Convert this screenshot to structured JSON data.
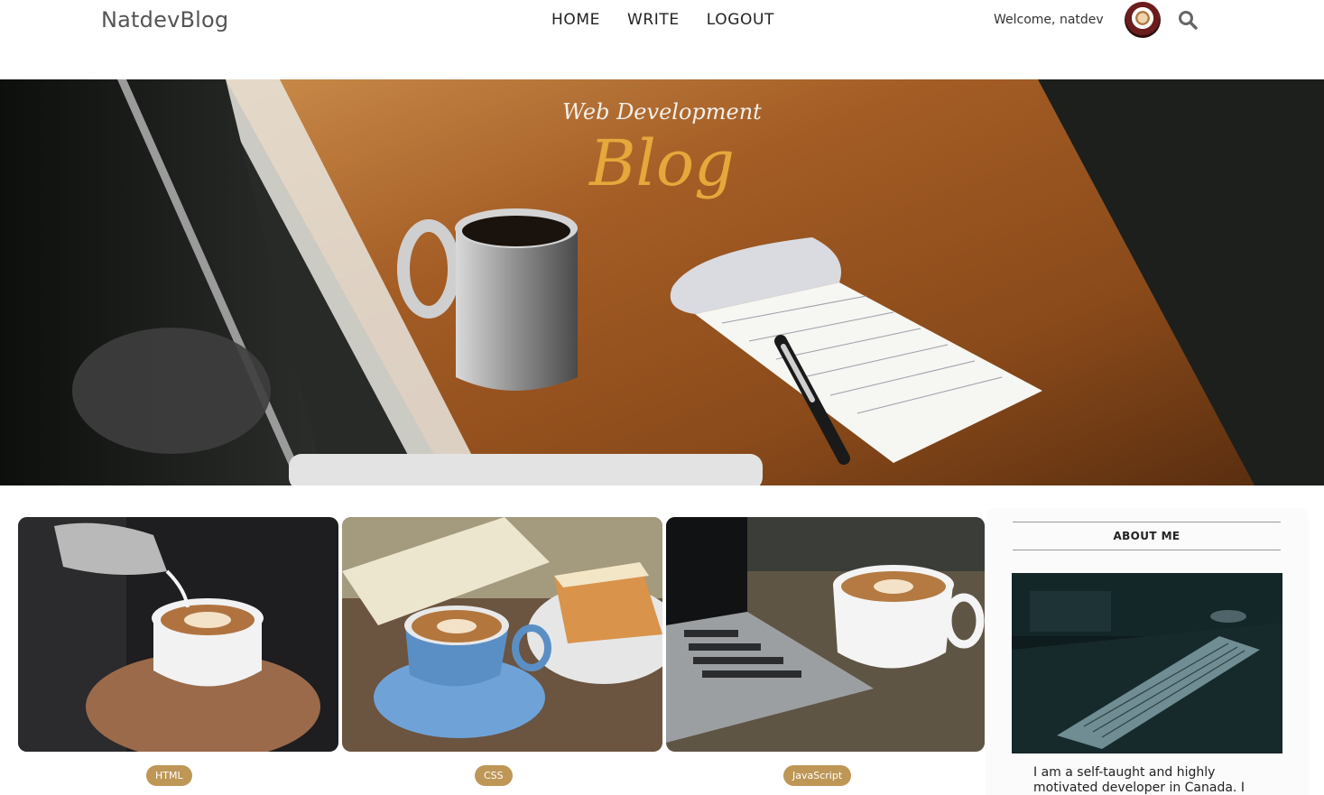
{
  "header": {
    "brand": "NatdevBlog",
    "nav": [
      "HOME",
      "WRITE",
      "LOGOUT"
    ],
    "welcome": "Welcome, natdev",
    "icons": {
      "avatar": "profile-avatar",
      "search": "search-icon"
    }
  },
  "hero": {
    "subtitle": "Web Development",
    "title": "Blog"
  },
  "posts": [
    {
      "category": "HTML"
    },
    {
      "category": "CSS"
    },
    {
      "category": "JavaScript"
    }
  ],
  "sidebar": {
    "title": "ABOUT ME",
    "text": "I am a self-taught and highly motivated developer in Canada. I"
  },
  "colors": {
    "accent": "#e6a83a",
    "tag": "#be9656"
  }
}
